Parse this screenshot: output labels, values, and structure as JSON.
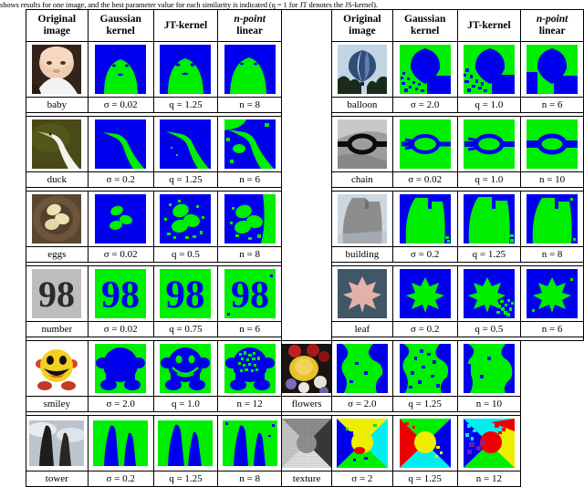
{
  "caption": "shows results for one image, and the best parameter value for each similarity is indicated (q = 1 for JT denotes the JS-kernel).",
  "table": {
    "headers_left": [
      {
        "line1": "Original",
        "line2": "image"
      },
      {
        "line1": "Gaussian",
        "line2": "kernel"
      },
      {
        "line1": "JT-kernel",
        "line2": ""
      },
      {
        "line1": "n-point",
        "line2": "linear"
      }
    ],
    "headers_right": [
      {
        "line1": "Original",
        "line2": "image"
      },
      {
        "line1": "Gaussian",
        "line2": "kernel"
      },
      {
        "line1": "JT-kernel",
        "line2": ""
      },
      {
        "line1": "n-point",
        "line2": "linear"
      }
    ],
    "rows": [
      {
        "left": {
          "name": "baby",
          "gaussian": "σ = 0.02",
          "jt": "q = 1.25",
          "npoint": "n = 8"
        },
        "right": {
          "name": "balloon",
          "gaussian": "σ = 2.0",
          "jt": "q = 1.0",
          "npoint": "n = 6"
        }
      },
      {
        "left": {
          "name": "duck",
          "gaussian": "σ = 0.2",
          "jt": "q = 1.25",
          "npoint": "n = 6"
        },
        "right": {
          "name": "chain",
          "gaussian": "σ = 0.02",
          "jt": "q = 1.0",
          "npoint": "n = 10"
        }
      },
      {
        "left": {
          "name": "eggs",
          "gaussian": "σ = 0.02",
          "jt": "q = 0.5",
          "npoint": "n = 8"
        },
        "right": {
          "name": "building",
          "gaussian": "σ = 0.2",
          "jt": "q = 1.25",
          "npoint": "n = 8"
        }
      },
      {
        "left": {
          "name": "number",
          "gaussian": "σ = 0.02",
          "jt": "q = 0.75",
          "npoint": "n = 6"
        },
        "right": {
          "name": "leaf",
          "gaussian": "σ = 0.2",
          "jt": "q = 0.5",
          "npoint": "n = 6"
        }
      },
      {
        "left": {
          "name": "smiley",
          "gaussian": "σ = 2.0",
          "jt": "q = 1.0",
          "npoint": "n = 12"
        },
        "right": {
          "name": "flowers",
          "gaussian": "σ = 2.0",
          "jt": "q = 1.25",
          "npoint": "n = 10"
        }
      },
      {
        "left": {
          "name": "tower",
          "gaussian": "σ = 0.2",
          "jt": "q = 1.25",
          "npoint": "n = 8"
        },
        "right": {
          "name": "texture",
          "gaussian": "σ = 2",
          "jt": "q = 1.25",
          "npoint": "n = 12"
        }
      }
    ]
  },
  "colors": {
    "segment_green": "#00ee00",
    "segment_blue": "#0000ee",
    "segment_red": "#ee0000",
    "segment_yellow": "#eeee00",
    "segment_cyan": "#00eeee",
    "border": "#000000",
    "background": "#ffffff"
  }
}
